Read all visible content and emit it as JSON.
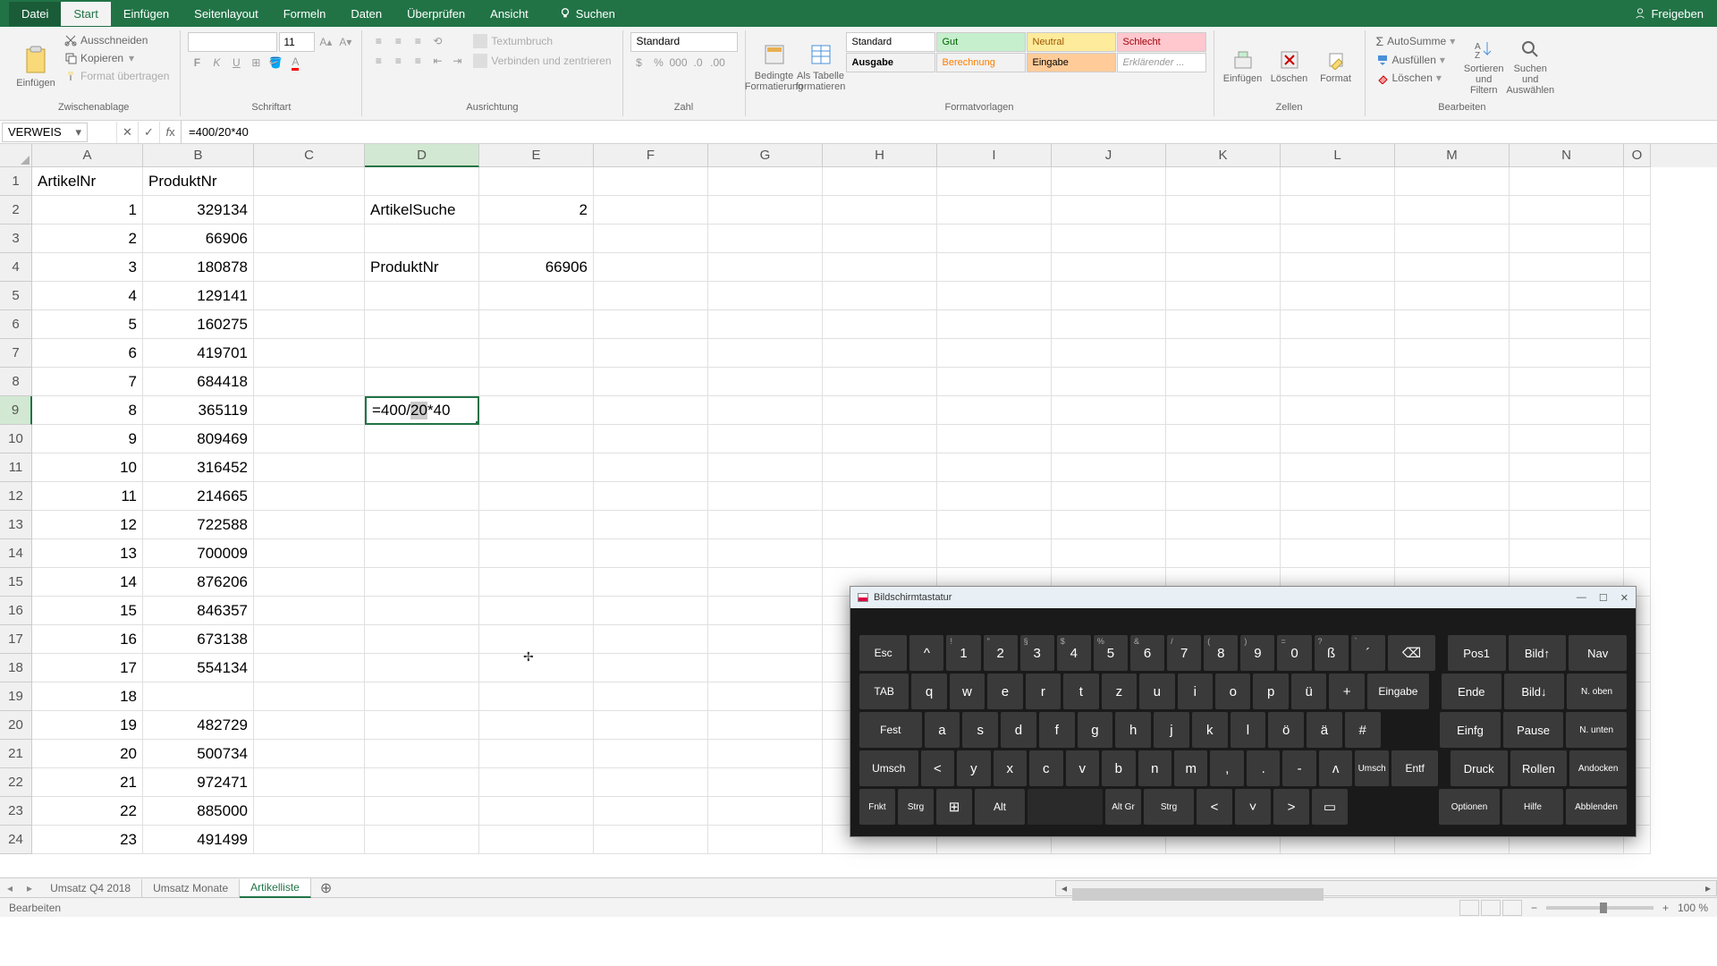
{
  "app": {
    "share": "Freigeben"
  },
  "tabs": {
    "file": "Datei",
    "start": "Start",
    "insert": "Einfügen",
    "layout": "Seitenlayout",
    "formulas": "Formeln",
    "data": "Daten",
    "review": "Überprüfen",
    "view": "Ansicht",
    "search": "Suchen"
  },
  "ribbon": {
    "paste": "Einfügen",
    "cut": "Ausschneiden",
    "copy": "Kopieren",
    "formatPainter": "Format übertragen",
    "clipboard": "Zwischenablage",
    "font": "",
    "fontSize": "11",
    "fontGroup": "Schriftart",
    "alignGroup": "Ausrichtung",
    "wrap": "Textumbruch",
    "merge": "Verbinden und zentrieren",
    "numberFormat": "Standard",
    "numberGroup": "Zahl",
    "condFmt": "Bedingte Formatierung",
    "asTable": "Als Tabelle formatieren",
    "stylesGroup": "Formatvorlagen",
    "styles": {
      "standard": "Standard",
      "gut": "Gut",
      "neutral": "Neutral",
      "schlecht": "Schlecht",
      "ausgabe": "Ausgabe",
      "berechnung": "Berechnung",
      "eingabe": "Eingabe",
      "erkl": "Erklärender ..."
    },
    "insert2": "Einfügen",
    "delete": "Löschen",
    "format": "Format",
    "cellsGroup": "Zellen",
    "autosum": "AutoSumme",
    "fill": "Ausfüllen",
    "clear": "Löschen",
    "sort": "Sortieren und Filtern",
    "find": "Suchen und Auswählen",
    "editGroup": "Bearbeiten"
  },
  "formulaBar": {
    "nameBox": "VERWEIS",
    "formula": "=400/20*40"
  },
  "columns": [
    "A",
    "B",
    "C",
    "D",
    "E",
    "F",
    "G",
    "H",
    "I",
    "J",
    "K",
    "L",
    "M",
    "N",
    "O"
  ],
  "headers": {
    "A1": "ArtikelNr",
    "B1": "ProduktNr"
  },
  "labels": {
    "D2": "ArtikelSuche",
    "E2": "2",
    "D4": "ProduktNr",
    "E4": "66906"
  },
  "editing": {
    "cell": "D9",
    "value": "=400/20*40"
  },
  "rows": [
    {
      "n": 1,
      "a": "1",
      "b": "329134"
    },
    {
      "n": 2,
      "a": "2",
      "b": "66906"
    },
    {
      "n": 3,
      "a": "3",
      "b": "180878"
    },
    {
      "n": 4,
      "a": "4",
      "b": "129141"
    },
    {
      "n": 5,
      "a": "5",
      "b": "160275"
    },
    {
      "n": 6,
      "a": "6",
      "b": "419701"
    },
    {
      "n": 7,
      "a": "7",
      "b": "684418"
    },
    {
      "n": 8,
      "a": "8",
      "b": "365119"
    },
    {
      "n": 9,
      "a": "9",
      "b": "809469"
    },
    {
      "n": 10,
      "a": "10",
      "b": "316452"
    },
    {
      "n": 11,
      "a": "11",
      "b": "214665"
    },
    {
      "n": 12,
      "a": "12",
      "b": "722588"
    },
    {
      "n": 13,
      "a": "13",
      "b": "700009"
    },
    {
      "n": 14,
      "a": "14",
      "b": "876206"
    },
    {
      "n": 15,
      "a": "15",
      "b": "846357"
    },
    {
      "n": 16,
      "a": "16",
      "b": "673138"
    },
    {
      "n": 17,
      "a": "17",
      "b": "554134"
    },
    {
      "n": 18,
      "a": "18",
      "b": ""
    },
    {
      "n": 19,
      "a": "19",
      "b": "482729"
    },
    {
      "n": 20,
      "a": "20",
      "b": "500734"
    },
    {
      "n": 21,
      "a": "21",
      "b": "972471"
    },
    {
      "n": 22,
      "a": "22",
      "b": "885000"
    },
    {
      "n": 23,
      "a": "23",
      "b": "491499"
    }
  ],
  "sheets": {
    "s1": "Umsatz Q4 2018",
    "s2": "Umsatz Monate",
    "s3": "Artikelliste"
  },
  "status": {
    "mode": "Bearbeiten",
    "zoom": "100 %"
  },
  "osk": {
    "title": "Bildschirmtastatur",
    "r1": [
      "Esc",
      "^",
      "1",
      "2",
      "3",
      "4",
      "5",
      "6",
      "7",
      "8",
      "9",
      "0",
      "ß",
      "´",
      "⌫"
    ],
    "r1sup": [
      "",
      "",
      "!",
      "\"",
      "§",
      "$",
      "%",
      "&",
      "/",
      "(",
      ")",
      "=",
      "?",
      "`",
      ""
    ],
    "nav1": [
      "Pos1",
      "Bild↑",
      "Nav"
    ],
    "r2": [
      "TAB",
      "q",
      "w",
      "e",
      "r",
      "t",
      "z",
      "u",
      "i",
      "o",
      "p",
      "ü",
      "+",
      "Eingabe"
    ],
    "nav2": [
      "Ende",
      "Bild↓",
      "N. oben"
    ],
    "r3": [
      "Fest",
      "a",
      "s",
      "d",
      "f",
      "g",
      "h",
      "j",
      "k",
      "l",
      "ö",
      "ä",
      "#"
    ],
    "nav3": [
      "Einfg",
      "Pause",
      "N. unten"
    ],
    "r4": [
      "Umsch",
      "<",
      "y",
      "x",
      "c",
      "v",
      "b",
      "n",
      "m",
      ",",
      ".",
      "-",
      "ʌ",
      "Umsch",
      "Entf"
    ],
    "nav4": [
      "Druck",
      "Rollen",
      "Andocken"
    ],
    "r5": [
      "Fnkt",
      "Strg",
      "⊞",
      "Alt",
      "",
      "Alt Gr",
      "Strg",
      "<",
      "˅",
      ">",
      "▭"
    ],
    "nav5": [
      "Optionen",
      "Hilfe",
      "Abblenden"
    ]
  }
}
